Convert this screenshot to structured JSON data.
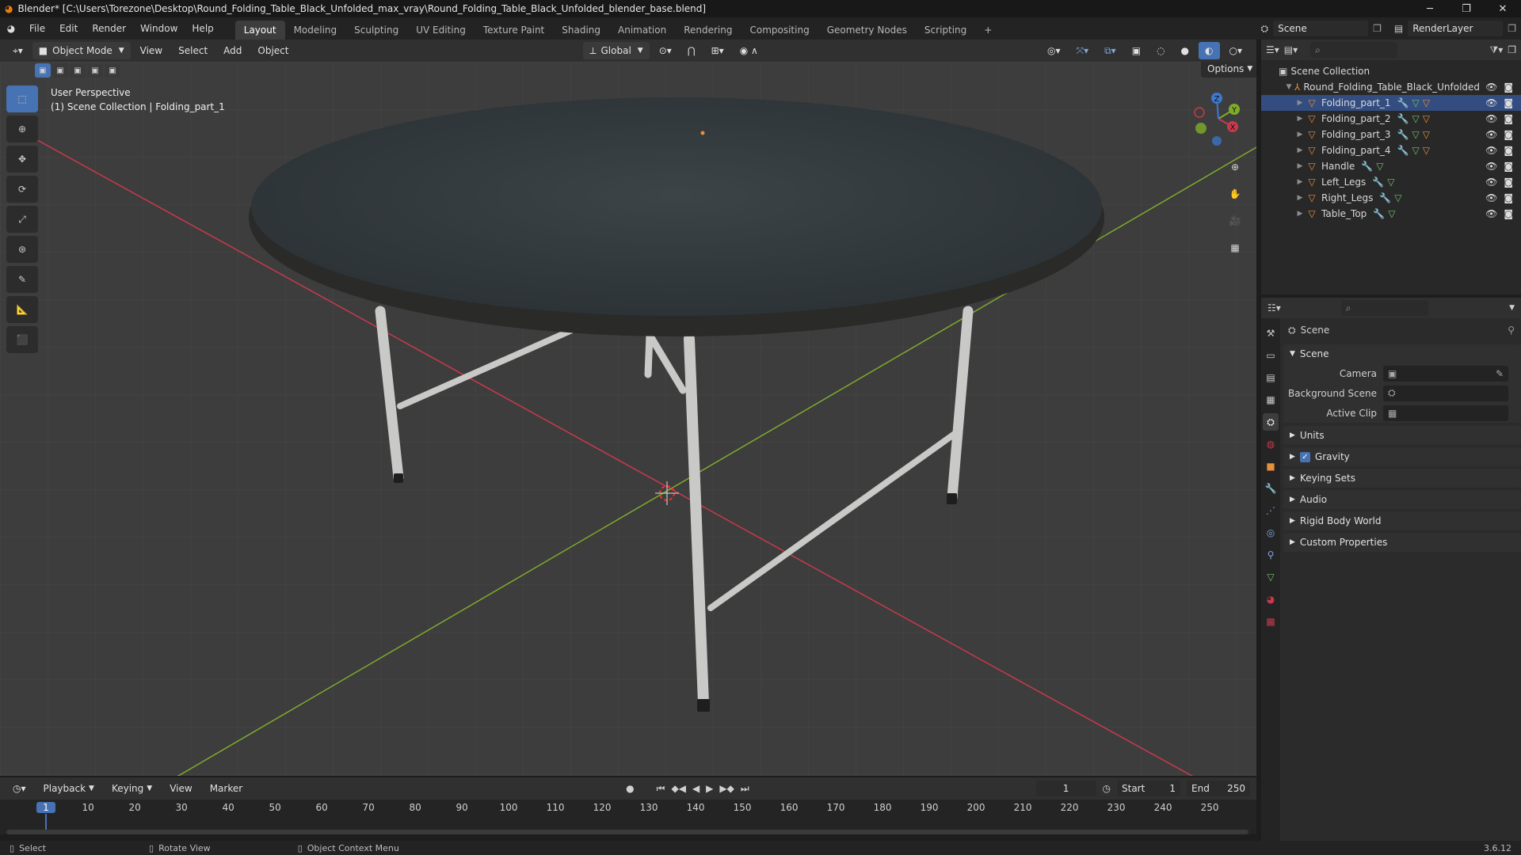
{
  "titlebar": {
    "title": "Blender* [C:\\Users\\Torezone\\Desktop\\Round_Folding_Table_Black_Unfolded_max_vray\\Round_Folding_Table_Black_Unfolded_blender_base.blend]",
    "minimize": "─",
    "maximize": "❐",
    "close": "✕"
  },
  "menubar": {
    "menus": [
      "File",
      "Edit",
      "Render",
      "Window",
      "Help"
    ],
    "workspaces": [
      "Layout",
      "Modeling",
      "Sculpting",
      "UV Editing",
      "Texture Paint",
      "Shading",
      "Animation",
      "Rendering",
      "Compositing",
      "Geometry Nodes",
      "Scripting"
    ],
    "add_workspace": "+",
    "scene_name": "Scene",
    "view_layer": "RenderLayer"
  },
  "viewport_header": {
    "mode": "Object Mode",
    "menus": [
      "View",
      "Select",
      "Add",
      "Object"
    ],
    "transform_orientation": "Global",
    "options_label": "Options"
  },
  "viewport": {
    "perspective_label": "User Perspective",
    "collection_label": "(1) Scene Collection | Folding_part_1",
    "gizmo": {
      "x": "X",
      "y": "Y",
      "z": "Z"
    }
  },
  "outliner": {
    "root": "Scene Collection",
    "collection": "Round_Folding_Table_Black_Unfolded",
    "objects": [
      {
        "name": "Folding_part_1"
      },
      {
        "name": "Folding_part_2"
      },
      {
        "name": "Folding_part_3"
      },
      {
        "name": "Folding_part_4"
      },
      {
        "name": "Handle"
      },
      {
        "name": "Left_Legs"
      },
      {
        "name": "Right_Legs"
      },
      {
        "name": "Table_Top"
      }
    ]
  },
  "properties": {
    "context": "Scene",
    "scene_panel": {
      "title": "Scene",
      "camera_label": "Camera",
      "background_scene_label": "Background Scene",
      "active_clip_label": "Active Clip"
    },
    "collapsed_panels": [
      "Units",
      "Gravity",
      "Keying Sets",
      "Audio",
      "Rigid Body World",
      "Custom Properties"
    ]
  },
  "timeline": {
    "menus": [
      "Playback",
      "Keying",
      "View",
      "Marker"
    ],
    "current_frame": "1",
    "start_label": "Start",
    "start_value": "1",
    "end_label": "End",
    "end_value": "250",
    "ticks": [
      "1",
      "10",
      "20",
      "30",
      "40",
      "50",
      "60",
      "70",
      "80",
      "90",
      "100",
      "110",
      "120",
      "130",
      "140",
      "150",
      "160",
      "170",
      "180",
      "190",
      "200",
      "210",
      "220",
      "230",
      "240",
      "250"
    ]
  },
  "statusbar": {
    "select": "Select",
    "rotate": "Rotate View",
    "context_menu": "Object Context Menu",
    "version": "3.6.12"
  },
  "colors": {
    "accent": "#4772b3",
    "object_icon": "#e88f3a",
    "x_axis": "#c9394e",
    "y_axis": "#7fab2b",
    "z_axis": "#3a7ad4"
  }
}
